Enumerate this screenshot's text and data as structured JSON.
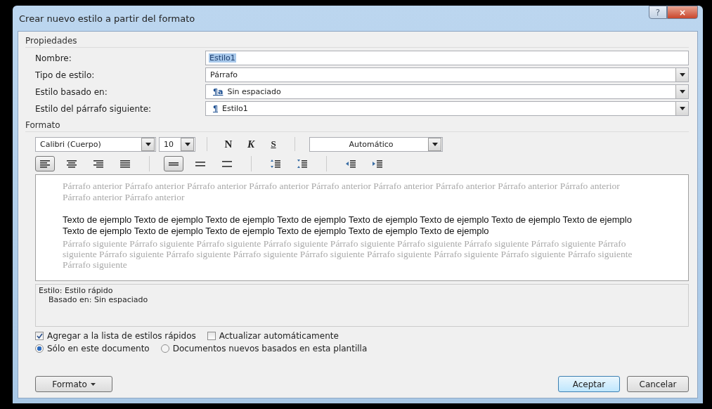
{
  "window": {
    "title": "Crear nuevo estilo a partir del formato",
    "help_button": "?",
    "close_button": "×"
  },
  "properties": {
    "label": "Propiedades",
    "fields": [
      {
        "kind": "text",
        "label": "Nombre:",
        "value": "Estilo1",
        "selected_text": true
      },
      {
        "kind": "combo",
        "label": "Tipo de estilo:",
        "value": "Párrafo"
      },
      {
        "kind": "combo",
        "label": "Estilo basado en:",
        "value": "Sin espaciado",
        "glyph": "¶a"
      },
      {
        "kind": "combo",
        "label": "Estilo del párrafo siguiente:",
        "value": "Estilo1",
        "glyph": "¶"
      }
    ]
  },
  "format": {
    "label": "Formato",
    "font": "Calibri (Cuerpo)",
    "size": "10",
    "styles": [
      {
        "label": "N",
        "kind": "bold",
        "selected": false
      },
      {
        "label": "K",
        "kind": "italic",
        "selected": false
      },
      {
        "label": "S",
        "kind": "underline",
        "selected": false
      }
    ],
    "color_label": "Automático",
    "paragraph_buttons": [
      {
        "kind": "align-left",
        "selected": true
      },
      {
        "kind": "align-center",
        "selected": false
      },
      {
        "kind": "align-right",
        "selected": false
      },
      {
        "kind": "justify",
        "selected": false
      },
      {
        "kind": "sep"
      },
      {
        "kind": "single-spacing",
        "selected": true
      },
      {
        "kind": "one-half-spacing",
        "selected": false
      },
      {
        "kind": "double-spacing",
        "selected": false
      },
      {
        "kind": "sep"
      },
      {
        "kind": "space-before",
        "selected": false
      },
      {
        "kind": "space-after",
        "selected": false
      },
      {
        "kind": "sep"
      },
      {
        "kind": "decrease-indent",
        "selected": false
      },
      {
        "kind": "increase-indent",
        "selected": false
      }
    ]
  },
  "preview": {
    "previous": "Párrafo anterior Párrafo anterior Párrafo anterior Párrafo anterior Párrafo anterior Párrafo anterior Párrafo anterior Párrafo anterior Párrafo anterior Párrafo anterior Párrafo anterior",
    "sample": "Texto de ejemplo Texto de ejemplo Texto de ejemplo Texto de ejemplo Texto de ejemplo Texto de ejemplo Texto de ejemplo Texto de ejemplo Texto de ejemplo Texto de ejemplo Texto de ejemplo Texto de ejemplo Texto de ejemplo Texto de ejemplo",
    "following": "Párrafo siguiente Párrafo siguiente Párrafo siguiente Párrafo siguiente Párrafo siguiente Párrafo siguiente Párrafo siguiente Párrafo siguiente Párrafo siguiente Párrafo siguiente Párrafo siguiente Párrafo siguiente Párrafo siguiente Párrafo siguiente Párrafo siguiente Párrafo siguiente Párrafo siguiente Párrafo siguiente"
  },
  "description": [
    "Estilo: Estilo rápido",
    "Basado en: Sin espaciado"
  ],
  "checkboxes": [
    {
      "label": "Agregar a la lista de estilos rápidos",
      "checked": true
    },
    {
      "label": "Actualizar automáticamente",
      "checked": false
    }
  ],
  "radios": [
    {
      "label": "Sólo en este documento",
      "selected": true
    },
    {
      "label": "Documentos nuevos basados en esta plantilla",
      "selected": false
    }
  ],
  "format_button": "Formato",
  "ok_button": "Aceptar",
  "cancel_button": "Cancelar"
}
